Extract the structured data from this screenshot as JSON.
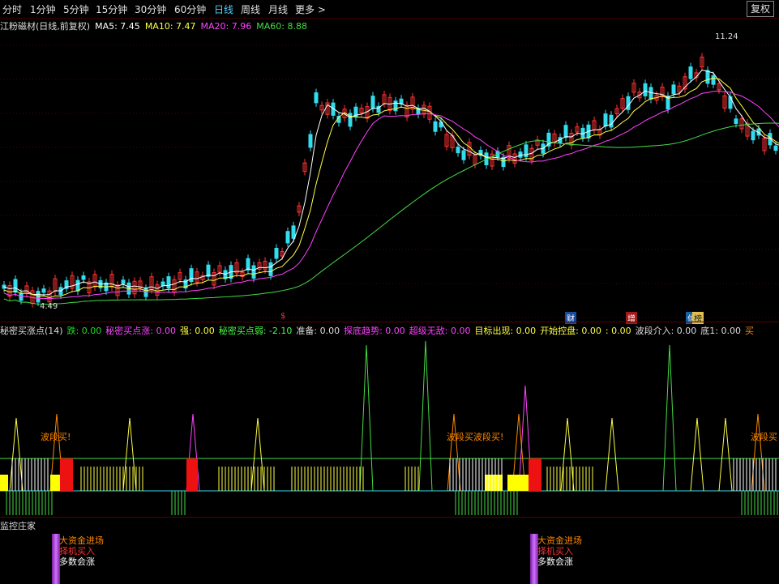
{
  "period_tabs": [
    {
      "label": "分时",
      "active": false
    },
    {
      "label": "1分钟",
      "active": false
    },
    {
      "label": "5分钟",
      "active": false
    },
    {
      "label": "15分钟",
      "active": false
    },
    {
      "label": "30分钟",
      "active": false
    },
    {
      "label": "60分钟",
      "active": false
    },
    {
      "label": "日线",
      "active": true
    },
    {
      "label": "周线",
      "active": false
    },
    {
      "label": "月线",
      "active": false
    },
    {
      "label": "更多 >",
      "active": false
    }
  ],
  "fq_button": "复权",
  "ma_legend": {
    "title": "江粉磁材(日线,前复权)",
    "ma5": "MA5: 7.45",
    "ma10": "MA10: 7.47",
    "ma20": "MA20: 7.96",
    "ma60": "MA60: 8.88"
  },
  "price_labels": {
    "high": "11.24",
    "low": "4.49"
  },
  "event_markers": [
    "$",
    "财",
    "增",
    "信",
    "榜"
  ],
  "indicator_legend": [
    {
      "text": "秘密买涨点(14)",
      "color": "#dddddd"
    },
    {
      "text": "跌: 0.00",
      "color": "#22dd22"
    },
    {
      "text": "秘密买点涨: 0.00",
      "color": "#ff44ff"
    },
    {
      "text": "强: 0.00",
      "color": "#ffff44"
    },
    {
      "text": "秘密买点弱: -2.10",
      "color": "#44ff44"
    },
    {
      "text": "准备: 0.00",
      "color": "#dddddd"
    },
    {
      "text": "探底趋势: 0.00",
      "color": "#ff44ff"
    },
    {
      "text": "超级无敌: 0.00",
      "color": "#ff44ff"
    },
    {
      "text": "目标出现: 0.00",
      "color": "#ffff44"
    },
    {
      "text": "开始控盘: 0.00",
      "color": "#ffff44"
    },
    {
      "text": ": 0.00",
      "color": "#ffff44"
    },
    {
      "text": "波段介入: 0.00",
      "color": "#dddddd"
    },
    {
      "text": "底1: 0.00",
      "color": "#dddddd"
    },
    {
      "text": "买",
      "color": "#ff8800"
    }
  ],
  "wave_buy_labels": [
    "波段买!",
    "波段买波段买!",
    "波段买"
  ],
  "monitor": {
    "title": "监控庄家",
    "groups": [
      {
        "items": [
          "大资金进场",
          "择机买入",
          "多数会涨"
        ]
      },
      {
        "items": [
          "大资金进场",
          "择机买入",
          "多数会涨"
        ]
      }
    ]
  },
  "colors": {
    "ma5": "#ffffff",
    "ma10": "#ffff44",
    "ma20": "#ff44ff",
    "ma60": "#44dd44",
    "up": "#ff3333",
    "down": "#33ddee",
    "grid": "#5a0000"
  }
}
